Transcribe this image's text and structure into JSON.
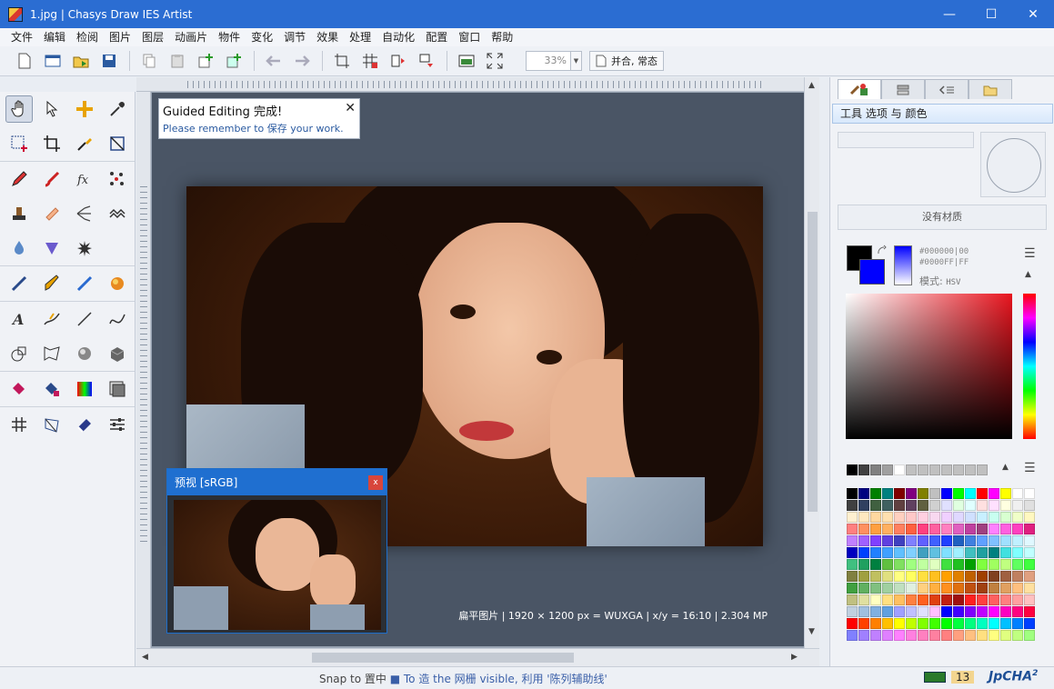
{
  "window": {
    "title": "1.jpg | Chasys Draw IES Artist",
    "minimize_glyph": "—",
    "maximize_glyph": "☐",
    "close_glyph": "✕"
  },
  "menu": [
    "文件",
    "编辑",
    "检阅",
    "图片",
    "图层",
    "动画片",
    "物件",
    "变化",
    "调节",
    "效果",
    "处理",
    "自动化",
    "配置",
    "窗口",
    "帮助"
  ],
  "toolbar": {
    "zoom": "33%",
    "merge_label": "并合, 常态"
  },
  "guided_popup": {
    "title": "Guided Editing 完成!",
    "message": "Please remember to 保存 your work.",
    "close_glyph": "✕"
  },
  "preview": {
    "title": "预视 [sRGB]",
    "close_glyph": "x"
  },
  "image_info": "扁平图片 | 1920 × 1200 px = WUXGA | x/y = 16:10 | 2.304 MP",
  "right_panel": {
    "header": "工具 选项 与 颜色",
    "no_material": "没有材质",
    "fg_hex": "#000000|00",
    "bg_hex": "#0000FF|FF",
    "mode_label": "模式:",
    "mode_value": "HSV",
    "fg_color": "#000000",
    "bg_color": "#0000ff"
  },
  "status": {
    "msg_a": "Snap to 置中",
    "msg_b": "To 造 the 网栅 visible, 利用 '陈列辅助线'",
    "count": "13",
    "logo": "JpCHA",
    "logo_sup": "2"
  },
  "quick_colors": [
    "#000000",
    "#404040",
    "#808080",
    "#a0a0a0",
    "#ffffff",
    "#c0c0c0",
    "#c0c0c0",
    "#c0c0c0",
    "#c0c0c0",
    "#c0c0c0",
    "#c0c0c0",
    "#c0c0c0"
  ],
  "palette": [
    "#000000",
    "#000080",
    "#008000",
    "#008080",
    "#800000",
    "#800080",
    "#808000",
    "#c0c0c0",
    "#0000ff",
    "#00ff00",
    "#00ffff",
    "#ff0000",
    "#ff00ff",
    "#ffff00",
    "#ffffff",
    "#ffffff",
    "#404040",
    "#304060",
    "#406040",
    "#406060",
    "#604040",
    "#604060",
    "#606040",
    "#d0d0d0",
    "#e0e0ff",
    "#e0ffe0",
    "#e0ffff",
    "#ffe0e0",
    "#ffe0ff",
    "#ffffe0",
    "#f0f0f0",
    "#e0e0e0",
    "#fff0d0",
    "#ffe8c0",
    "#ffd8a0",
    "#ffe0b0",
    "#ffd0c0",
    "#ffc8c8",
    "#ffd0e0",
    "#f8d8f0",
    "#f0d0ff",
    "#e0d8ff",
    "#d0e0ff",
    "#c8f0ff",
    "#c8fff0",
    "#d8ffd0",
    "#f0ffc8",
    "#fff8c0",
    "#ff8080",
    "#ff9060",
    "#ffa040",
    "#ffb060",
    "#ff8060",
    "#ff6040",
    "#ff4080",
    "#ff60a0",
    "#ff80c0",
    "#e060c0",
    "#c040a0",
    "#a04080",
    "#ff80ff",
    "#ff60e0",
    "#ff40c0",
    "#e02080",
    "#c080ff",
    "#a060ff",
    "#8040ff",
    "#6040e0",
    "#4040c0",
    "#8080ff",
    "#6060ff",
    "#4060ff",
    "#2040ff",
    "#2060c0",
    "#4080e0",
    "#60a0ff",
    "#80c0ff",
    "#a0e0ff",
    "#c0f0ff",
    "#e0f8ff",
    "#0000c0",
    "#0040ff",
    "#2080ff",
    "#40a0ff",
    "#60c0ff",
    "#80d0ff",
    "#40a0c0",
    "#60c0e0",
    "#80e0ff",
    "#a0f0ff",
    "#40c0c0",
    "#20a0a0",
    "#008080",
    "#40e0e0",
    "#80ffff",
    "#c0ffff",
    "#40c080",
    "#20a060",
    "#008040",
    "#60c040",
    "#80e060",
    "#a0ff80",
    "#c0ffa0",
    "#e0ffc0",
    "#40e040",
    "#20c020",
    "#00a000",
    "#80ff40",
    "#a0ff60",
    "#c0ff80",
    "#60ff60",
    "#40ff40",
    "#808040",
    "#a0a040",
    "#c0c060",
    "#e0e080",
    "#ffff80",
    "#ffff60",
    "#ffe040",
    "#ffc020",
    "#ffa000",
    "#e08000",
    "#c06000",
    "#a04000",
    "#804020",
    "#a06040",
    "#c08060",
    "#e0a080",
    "#40a040",
    "#60b060",
    "#80c080",
    "#a0d0a0",
    "#c0e0c0",
    "#e0f0e0",
    "#ffd080",
    "#ffb040",
    "#ff9020",
    "#e07010",
    "#c05010",
    "#a04010",
    "#c08040",
    "#e0a060",
    "#ffc080",
    "#ffe0a0",
    "#c0c080",
    "#e0e0a0",
    "#ffffc0",
    "#ffe080",
    "#ffc060",
    "#ff8040",
    "#ff6020",
    "#e04010",
    "#c02010",
    "#a01010",
    "#ff2020",
    "#ff4040",
    "#ff6060",
    "#ff8080",
    "#ffa0a0",
    "#ffc0c0",
    "#c0d0e0",
    "#a0c0e0",
    "#80b0e0",
    "#60a0e0",
    "#a0a0ff",
    "#c0c0ff",
    "#e0e0ff",
    "#ffc0ff",
    "#0000ff",
    "#4000ff",
    "#8000ff",
    "#c000ff",
    "#ff00ff",
    "#ff00c0",
    "#ff0080",
    "#ff0040",
    "#ff0000",
    "#ff4000",
    "#ff8000",
    "#ffc000",
    "#ffff00",
    "#c0ff00",
    "#80ff00",
    "#40ff00",
    "#00ff00",
    "#00ff40",
    "#00ff80",
    "#00ffc0",
    "#00ffff",
    "#00c0ff",
    "#0080ff",
    "#0040ff",
    "#8080ff",
    "#a080ff",
    "#c080ff",
    "#e080ff",
    "#ff80ff",
    "#ff80e0",
    "#ff80c0",
    "#ff80a0",
    "#ff8080",
    "#ffa080",
    "#ffc080",
    "#ffe080",
    "#ffff80",
    "#e0ff80",
    "#c0ff80",
    "#a0ff80"
  ]
}
